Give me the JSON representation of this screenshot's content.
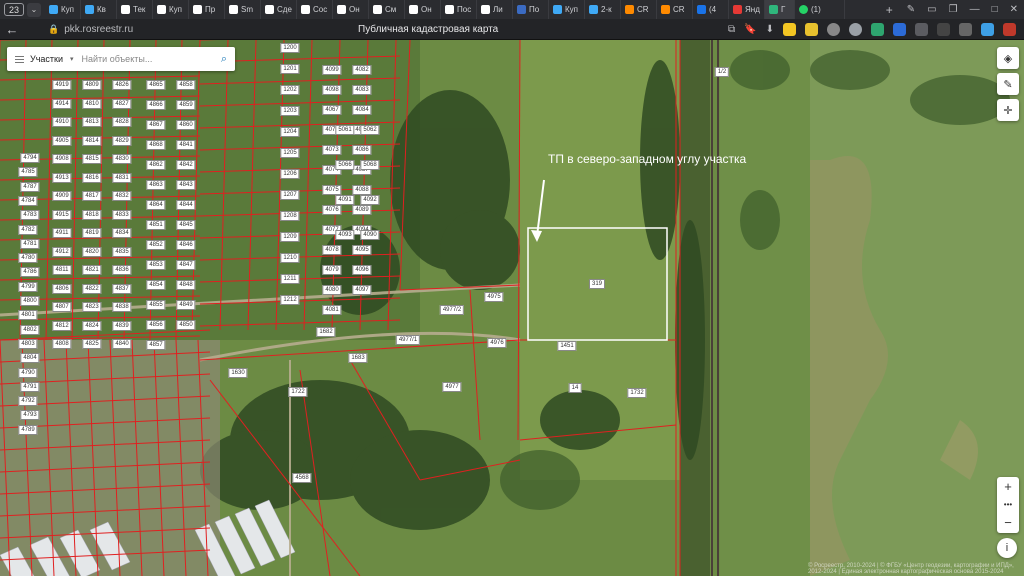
{
  "browser": {
    "tab_counter": "23",
    "tabs": [
      {
        "label": "Куп",
        "color": "#3fa9f5"
      },
      {
        "label": "Кв",
        "color": "#3fa9f5"
      },
      {
        "label": "Тек",
        "color": "#ffffff"
      },
      {
        "label": "Куп",
        "color": "#ffffff"
      },
      {
        "label": "Пр",
        "color": "#ffffff"
      },
      {
        "label": "Sm",
        "color": "#ffffff"
      },
      {
        "label": "Сде",
        "color": "#ffffff"
      },
      {
        "label": "Сос",
        "color": "#ffffff"
      },
      {
        "label": "Он",
        "color": "#ffffff"
      },
      {
        "label": "См",
        "color": "#ffffff"
      },
      {
        "label": "Он",
        "color": "#ffffff"
      },
      {
        "label": "Пос",
        "color": "#ffffff"
      },
      {
        "label": "Ли",
        "color": "#ffffff"
      },
      {
        "label": "По",
        "color": "#3b6bc2"
      },
      {
        "label": "Куп",
        "color": "#3fa9f5"
      },
      {
        "label": "2-к",
        "color": "#3fa9f5"
      },
      {
        "label": "CR",
        "color": "#ff8a00"
      },
      {
        "label": "CR",
        "color": "#ff8a00"
      },
      {
        "label": "(4",
        "color": "#1a73e8"
      },
      {
        "label": "Янд",
        "color": "#e53935"
      }
    ],
    "active_tab_label": "Г",
    "whatsapp_label": "(1)",
    "url": "pkk.rosreestr.ru",
    "page_title": "Публичная кадастровая карта"
  },
  "search": {
    "type_label": "Участки",
    "placeholder": "Найти объекты..."
  },
  "annotation": "ТП в северо-западном углу участка",
  "copyright": "© Росреестр, 2010-2024 | © ФГБУ «Центр геодезии, картографии и ИПД», 2012-2024 | Единая электронная картографическая основа 2015-2024",
  "map_controls": {
    "zoom_in": "+",
    "zoom_more": "•••",
    "zoom_out": "−",
    "info": "i"
  },
  "parcels": {
    "highlighted": "319",
    "left_block": [
      "4919",
      "4914",
      "4910",
      "4905",
      "4908",
      "4913",
      "4909",
      "4915",
      "4911",
      "4912",
      "4811",
      "4806",
      "4807",
      "4812",
      "4808",
      "4809",
      "4810",
      "4813",
      "4814",
      "4815",
      "4816",
      "4817",
      "4818",
      "4819",
      "4820",
      "4821",
      "4822",
      "4823",
      "4824",
      "4825",
      "4826",
      "4827",
      "4828",
      "4829",
      "4830",
      "4831",
      "4832",
      "4833",
      "4834",
      "4835",
      "4836",
      "4837",
      "4838",
      "4839",
      "4840"
    ],
    "col2": [
      "4794",
      "4785",
      "4787",
      "4784",
      "4783",
      "4782",
      "4781",
      "4780",
      "4786",
      "4799",
      "4800",
      "4801",
      "4802",
      "4803",
      "4804",
      "4790",
      "4791",
      "4792",
      "4793",
      "4789"
    ],
    "right_block": [
      "4865",
      "4866",
      "4867",
      "4868",
      "4862",
      "4863",
      "4864",
      "4851",
      "4852",
      "4853",
      "4854",
      "4855",
      "4856",
      "4857",
      "4858",
      "4859",
      "4860",
      "4841",
      "4842",
      "4843",
      "4844",
      "4845",
      "4846",
      "4847",
      "4848",
      "4849",
      "4850"
    ],
    "mid_col": [
      "1200",
      "1201",
      "1202",
      "1203",
      "1204",
      "1205",
      "1206",
      "1207",
      "1208",
      "1209",
      "1210",
      "1211",
      "1212"
    ],
    "mid2": [
      "4099",
      "4098",
      "4067",
      "4072",
      "4073",
      "4074",
      "4075",
      "4076",
      "4077",
      "4078",
      "4079",
      "4080",
      "4081",
      "4082",
      "4083",
      "4084",
      "4085",
      "4086",
      "4087",
      "4088",
      "4089",
      "4094",
      "4095",
      "4096",
      "4097"
    ],
    "mid3": [
      "5061",
      "5062",
      "5066",
      "5068",
      "4091",
      "4092",
      "4093",
      "4090"
    ],
    "others": [
      "4975",
      "4976",
      "4977/2",
      "4977/1",
      "1682",
      "1683",
      "1630",
      "1722",
      "1451",
      "1732",
      "14",
      "1/2",
      "4568",
      "4977"
    ]
  }
}
